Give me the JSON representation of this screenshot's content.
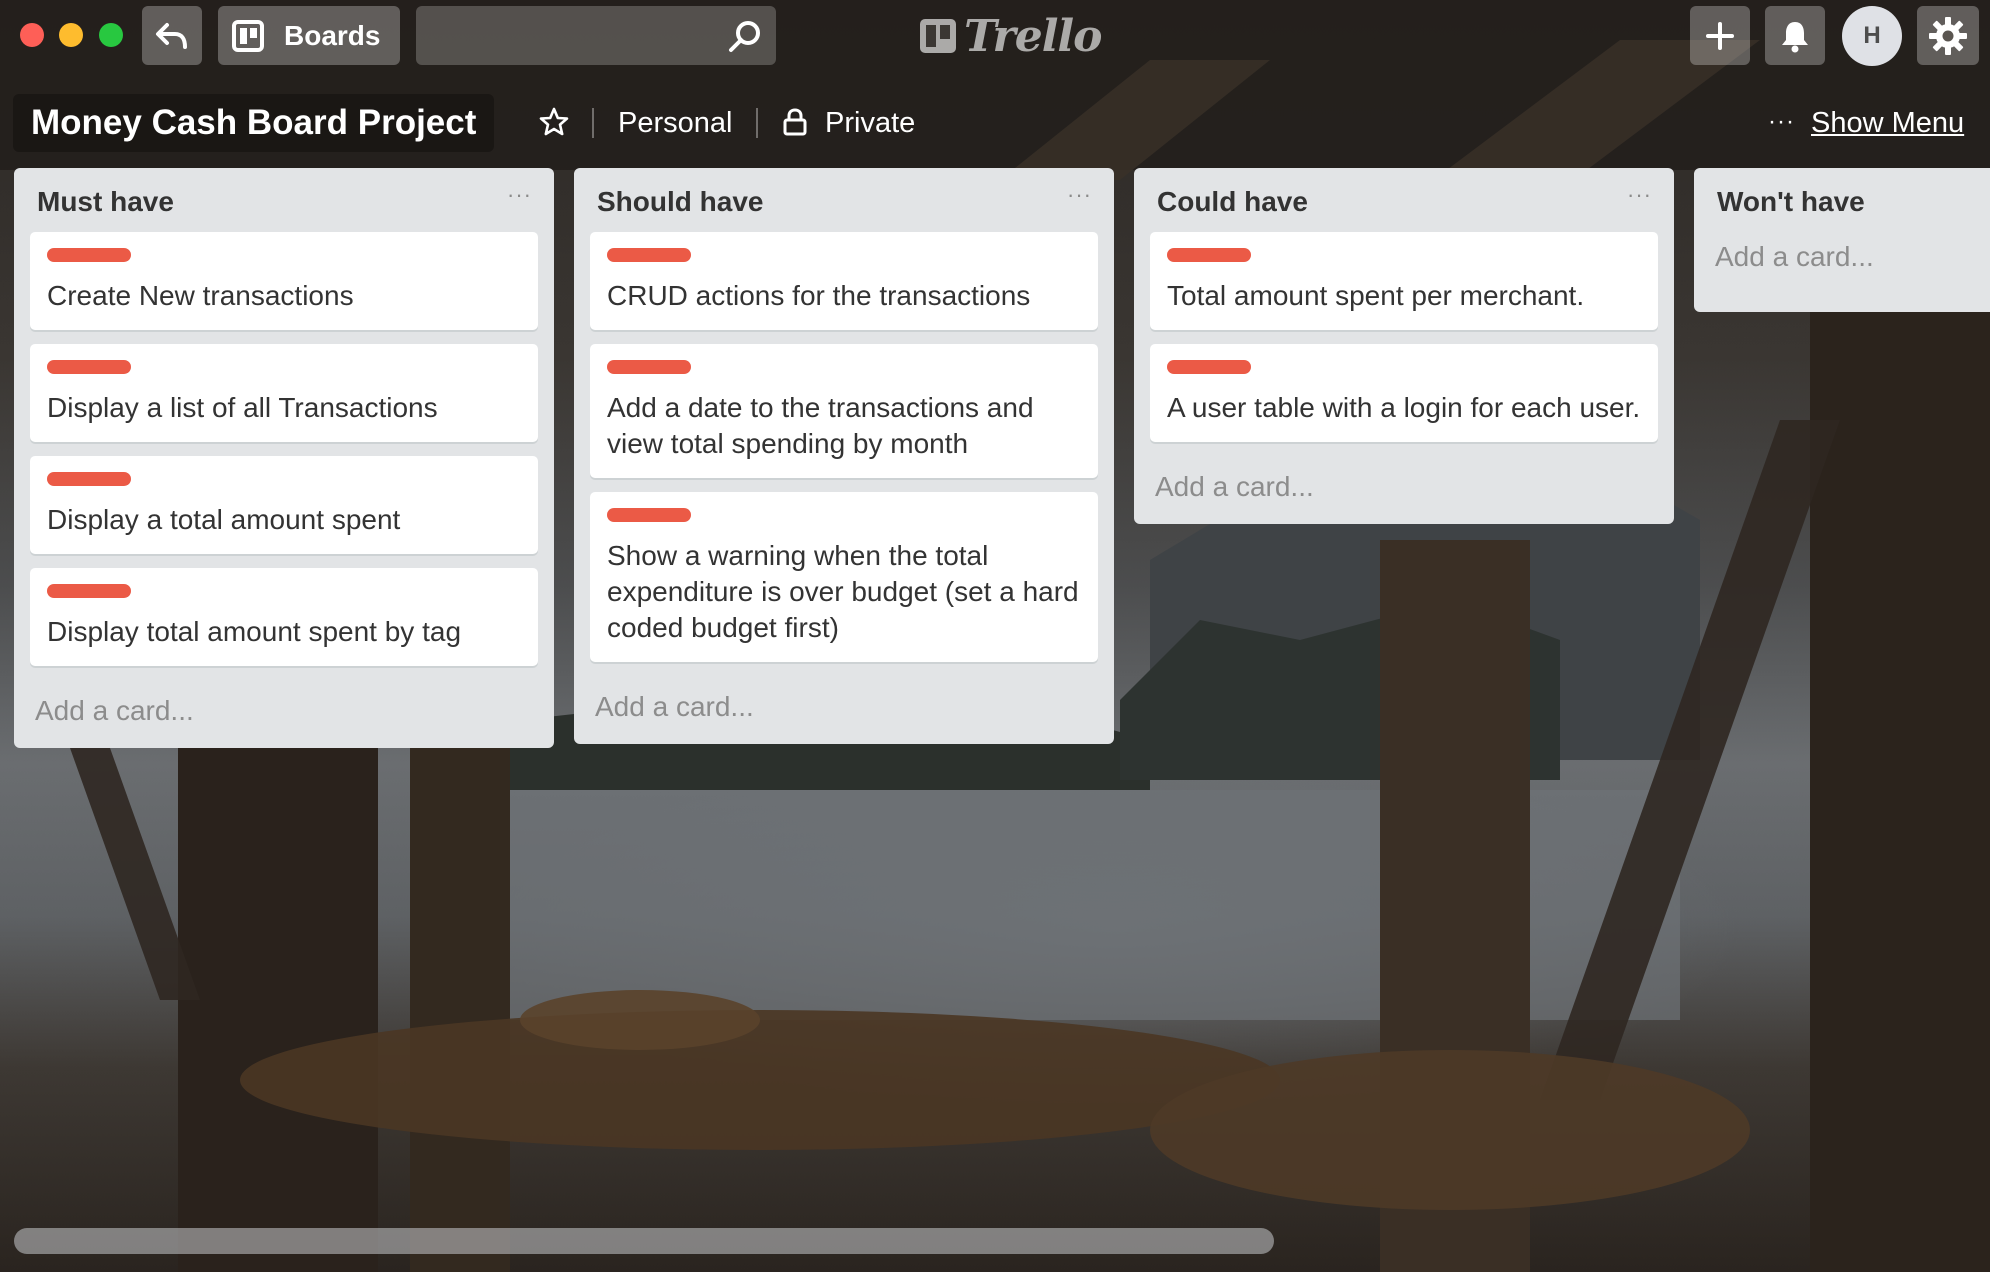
{
  "window": {
    "traffic_lights": [
      "#fe5f57",
      "#febc2e",
      "#28c840"
    ]
  },
  "topbar": {
    "back_icon": "back-arrow-icon",
    "boards_label": "Boards",
    "search_value": "",
    "search_placeholder": "",
    "logo_text": "Trello",
    "add_icon": "plus-icon",
    "notifications_icon": "bell-icon",
    "avatar_initial": "H",
    "settings_icon": "gear-icon"
  },
  "board": {
    "title": "Money Cash Board Project",
    "star_icon": "star-icon",
    "team": "Personal",
    "visibility": "Private",
    "menu_dots": "···",
    "show_menu": "Show Menu"
  },
  "colors": {
    "label_red": "#eb5a46",
    "list_bg": "#e2e4e6"
  },
  "lists": [
    {
      "title": "Must have",
      "menu": "···",
      "cards": [
        {
          "title": "Create New transactions"
        },
        {
          "title": "Display a list of all Transactions"
        },
        {
          "title": "Display a total amount spent"
        },
        {
          "title": "Display total amount spent by tag"
        }
      ],
      "add_card": "Add a card..."
    },
    {
      "title": "Should have",
      "menu": "···",
      "cards": [
        {
          "title": "CRUD actions for the transactions"
        },
        {
          "title": "Add a date to the transactions and view total spending by month"
        },
        {
          "title": "Show a warning when the total expenditure is over budget (set a hard coded budget first)"
        }
      ],
      "add_card": "Add a card..."
    },
    {
      "title": "Could have",
      "menu": "···",
      "cards": [
        {
          "title": "Total amount spent per merchant."
        },
        {
          "title": "A user table with a login for each user."
        }
      ],
      "add_card": "Add a card..."
    },
    {
      "title": "Won't have",
      "cards": [],
      "add_card": "Add a card..."
    }
  ]
}
